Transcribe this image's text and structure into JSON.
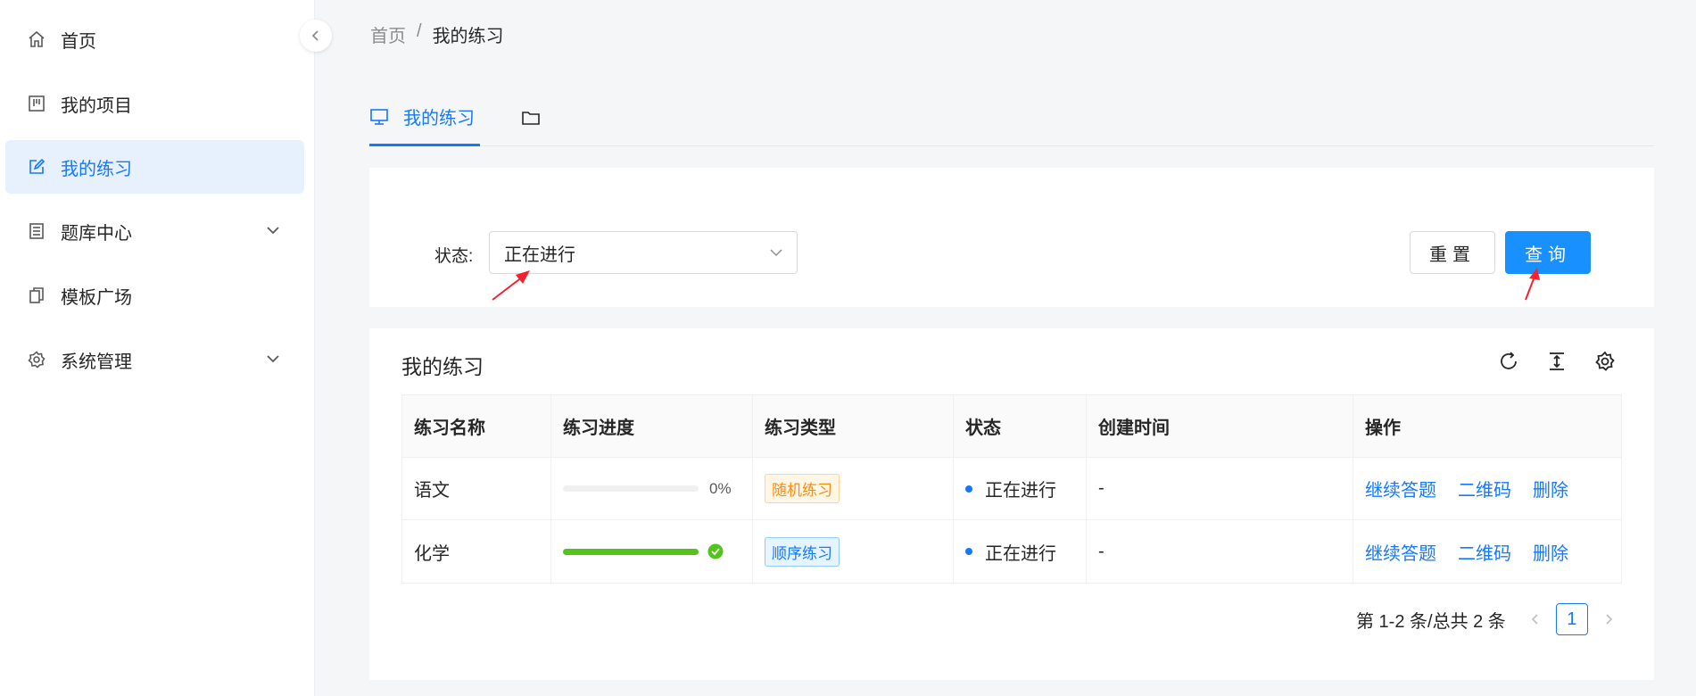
{
  "sidebar": {
    "items": [
      {
        "label": "首页",
        "icon": "home-icon"
      },
      {
        "label": "我的项目",
        "icon": "project-board-icon"
      },
      {
        "label": "我的练习",
        "icon": "edit-icon",
        "active": true
      },
      {
        "label": "题库中心",
        "icon": "book-icon",
        "expandable": true
      },
      {
        "label": "模板广场",
        "icon": "copy-icon"
      },
      {
        "label": "系统管理",
        "icon": "gear-icon",
        "expandable": true
      }
    ]
  },
  "breadcrumb": {
    "home": "首页",
    "separator": "/",
    "current": "我的练习"
  },
  "tabs": [
    {
      "label": "我的练习",
      "icon": "monitor-icon",
      "active": true
    },
    {
      "label": "",
      "icon": "folder-icon"
    }
  ],
  "filter": {
    "status_label": "状态:",
    "status_value": "正在进行",
    "reset_label": "重置",
    "query_label": "查询"
  },
  "table_card": {
    "title": "我的练习",
    "toolbar_icons": [
      "refresh-icon",
      "column-height-icon",
      "setting-icon"
    ],
    "columns": [
      "练习名称",
      "练习进度",
      "练习类型",
      "状态",
      "创建时间",
      "操作"
    ],
    "rows": [
      {
        "name": "语文",
        "progress": 0,
        "progress_text": "0%",
        "type": "随机练习",
        "type_color": "orange",
        "status": "正在进行",
        "created": "-",
        "actions": [
          "继续答题",
          "二维码",
          "删除"
        ]
      },
      {
        "name": "化学",
        "progress": 100,
        "progress_text": "",
        "type": "顺序练习",
        "type_color": "blue",
        "status": "正在进行",
        "created": "-",
        "actions": [
          "继续答题",
          "二维码",
          "删除"
        ]
      }
    ]
  },
  "pagination": {
    "summary": "第 1-2 条/总共 2 条",
    "current_page": "1"
  },
  "colors": {
    "primary": "#1677ff",
    "success": "#52c41a",
    "annotation_arrow": "#f5222d"
  }
}
